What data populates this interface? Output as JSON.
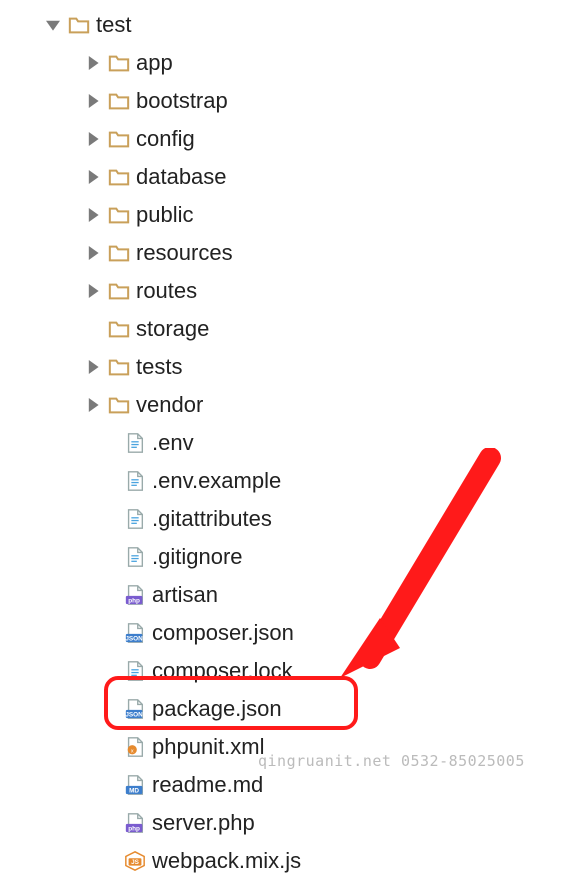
{
  "tree": {
    "root": {
      "name": "test",
      "type": "folder",
      "expanded": true
    },
    "folders": [
      {
        "name": "app"
      },
      {
        "name": "bootstrap"
      },
      {
        "name": "config"
      },
      {
        "name": "database"
      },
      {
        "name": "public"
      },
      {
        "name": "resources"
      },
      {
        "name": "routes"
      },
      {
        "name": "storage"
      },
      {
        "name": "tests"
      },
      {
        "name": "vendor"
      }
    ],
    "files": [
      {
        "name": ".env",
        "type": "text"
      },
      {
        "name": ".env.example",
        "type": "text"
      },
      {
        "name": ".gitattributes",
        "type": "text"
      },
      {
        "name": ".gitignore",
        "type": "text"
      },
      {
        "name": "artisan",
        "type": "php"
      },
      {
        "name": "composer.json",
        "type": "json"
      },
      {
        "name": "composer.lock",
        "type": "text"
      },
      {
        "name": "package.json",
        "type": "json",
        "highlighted": true
      },
      {
        "name": "phpunit.xml",
        "type": "xml"
      },
      {
        "name": "readme.md",
        "type": "md"
      },
      {
        "name": "server.php",
        "type": "php"
      },
      {
        "name": "webpack.mix.js",
        "type": "js"
      }
    ]
  },
  "watermark": "qingruanit.net 0532-85025005"
}
